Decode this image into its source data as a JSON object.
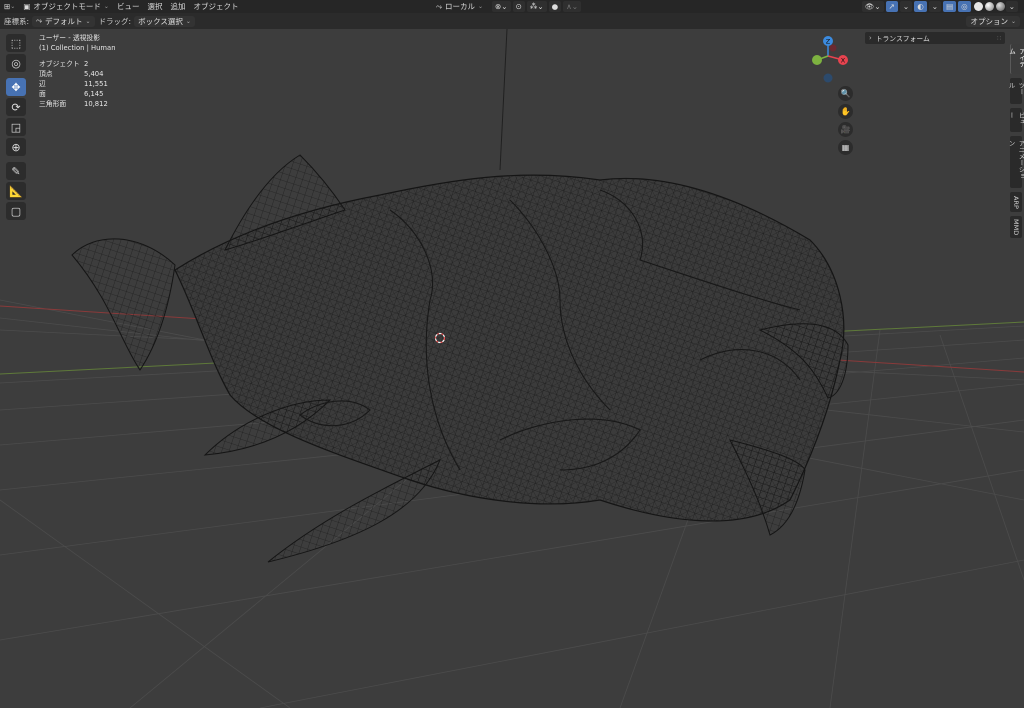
{
  "header": {
    "mode_label": "オブジェクトモード",
    "menus": [
      "ビュー",
      "選択",
      "追加",
      "オブジェクト"
    ],
    "transform_orientation": "ローカル"
  },
  "tool_header": {
    "orientation_label": "座標系:",
    "orientation_value": "デフォルト",
    "drag_label": "ドラッグ:",
    "drag_value": "ボックス選択",
    "options_label": "オプション"
  },
  "overlay": {
    "view_name": "ユーザー - 透視投影",
    "collection": "(1) Collection | Human",
    "stats": [
      {
        "label": "オブジェクト",
        "value": "2"
      },
      {
        "label": "頂点",
        "value": "5,404"
      },
      {
        "label": "辺",
        "value": "11,551"
      },
      {
        "label": "面",
        "value": "6,145"
      },
      {
        "label": "三角形面",
        "value": "10,812"
      }
    ]
  },
  "npanel": {
    "transform_label": "トランスフォーム"
  },
  "sidebar_tabs": [
    "アイテム",
    "ツール",
    "ビュー",
    "アニメーション",
    "ARP",
    "MMD"
  ],
  "gizmo": {
    "x": "X",
    "y": "Y",
    "z": "Z"
  },
  "colors": {
    "accent": "#4772b3",
    "x_axis": "#e8434f",
    "y_axis": "#7db240",
    "z_axis": "#3b8be0"
  }
}
